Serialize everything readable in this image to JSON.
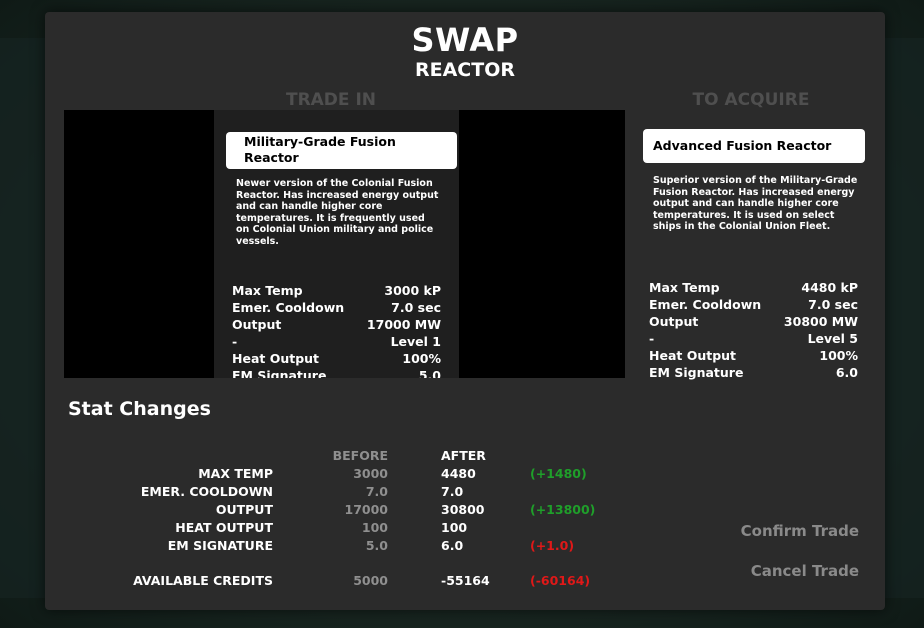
{
  "header": {
    "title": "SWAP",
    "subtitle": "REACTOR"
  },
  "trade_in": {
    "heading": "TRADE IN",
    "name_line1": "Military-Grade Fusion",
    "name_line2": "Reactor",
    "description": "Newer version of the Colonial Fusion Reactor. Has increased energy output and can handle higher core temperatures. It is frequently used on Colonial Union military and police vessels.",
    "stats": [
      {
        "label": "Max Temp",
        "value": "3000 kP"
      },
      {
        "label": "Emer. Cooldown",
        "value": "7.0 sec"
      },
      {
        "label": "Output",
        "value": "17000 MW"
      },
      {
        "label": "-",
        "value": "Level 1"
      },
      {
        "label": "Heat Output",
        "value": "100%"
      },
      {
        "label": "EM Signature",
        "value": "5.0"
      }
    ]
  },
  "to_acquire": {
    "heading": "TO ACQUIRE",
    "name": "Advanced Fusion Reactor",
    "description": "Superior version of the Military-Grade Fusion Reactor. Has increased energy output and can handle higher core temperatures. It is used on select ships in the Colonial Union Fleet.",
    "stats": [
      {
        "label": "Max Temp",
        "value": "4480 kP"
      },
      {
        "label": "Emer. Cooldown",
        "value": "7.0 sec"
      },
      {
        "label": "Output",
        "value": "30800 MW"
      },
      {
        "label": "-",
        "value": "Level 5"
      },
      {
        "label": "Heat Output",
        "value": "100%"
      },
      {
        "label": "EM Signature",
        "value": "6.0"
      }
    ]
  },
  "stat_changes": {
    "title": "Stat Changes",
    "col_before": "BEFORE",
    "col_after": "AFTER",
    "rows": [
      {
        "label": "MAX TEMP",
        "before": "3000",
        "after": "4480",
        "delta": "(+1480)",
        "delta_color": "#1f9f2a"
      },
      {
        "label": "EMER. COOLDOWN",
        "before": "7.0",
        "after": "7.0",
        "delta": "",
        "delta_color": ""
      },
      {
        "label": "OUTPUT",
        "before": "17000",
        "after": "30800",
        "delta": "(+13800)",
        "delta_color": "#1f9f2a"
      },
      {
        "label": "HEAT OUTPUT",
        "before": "100",
        "after": "100",
        "delta": "",
        "delta_color": ""
      },
      {
        "label": "EM SIGNATURE",
        "before": "5.0",
        "after": "6.0",
        "delta": "(+1.0)",
        "delta_color": "#e01818"
      }
    ],
    "credits": {
      "label": "AVAILABLE CREDITS",
      "before": "5000",
      "after": "-55164",
      "delta": "(-60164)",
      "delta_color": "#e01818"
    }
  },
  "actions": {
    "confirm": "Confirm Trade",
    "cancel": "Cancel Trade"
  }
}
